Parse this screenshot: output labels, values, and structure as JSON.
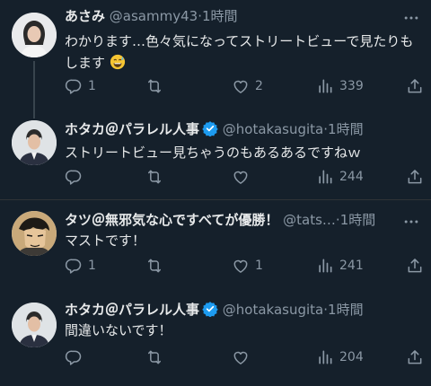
{
  "tweets": [
    {
      "name": "あさみ",
      "handle": "@asammy43",
      "dot": "·",
      "time": "1時間",
      "text_line1": "わかります…色々気になってストリートビューで見たりも",
      "text_line2": "します",
      "emoji": "grinning-sweat-emoji",
      "verified": false,
      "replies": "1",
      "retweets": "",
      "likes": "2",
      "views": "339"
    },
    {
      "name": "ホタカ＠パラレル人事",
      "handle": "@hotakasugita",
      "dot": "·",
      "time": "1時間",
      "text_line1": "ストリートビュー見ちゃうのもあるあるですねｗ",
      "verified": true,
      "replies": "",
      "retweets": "",
      "likes": "",
      "views": "244"
    },
    {
      "name": "タツ＠無邪気な心ですべてが優勝！",
      "handle": "@tats…",
      "dot": "·",
      "time": "1時間",
      "text_line1": "マストです！",
      "verified": false,
      "replies": "1",
      "retweets": "",
      "likes": "1",
      "views": "241"
    },
    {
      "name": "ホタカ＠パラレル人事",
      "handle": "@hotakasugita",
      "dot": "·",
      "time": "1時間",
      "text_line1": "間違いないです！",
      "verified": true,
      "replies": "",
      "retweets": "",
      "likes": "",
      "views": "204"
    }
  ],
  "colors": {
    "background": "#15202b",
    "text": "#e7e9ea",
    "muted": "#8b98a5",
    "verified": "#1d9bf0",
    "divider": "#2f3336"
  },
  "icons": [
    "more-icon",
    "reply-icon",
    "retweet-icon",
    "like-icon",
    "views-icon",
    "share-icon",
    "verified-badge-icon"
  ]
}
